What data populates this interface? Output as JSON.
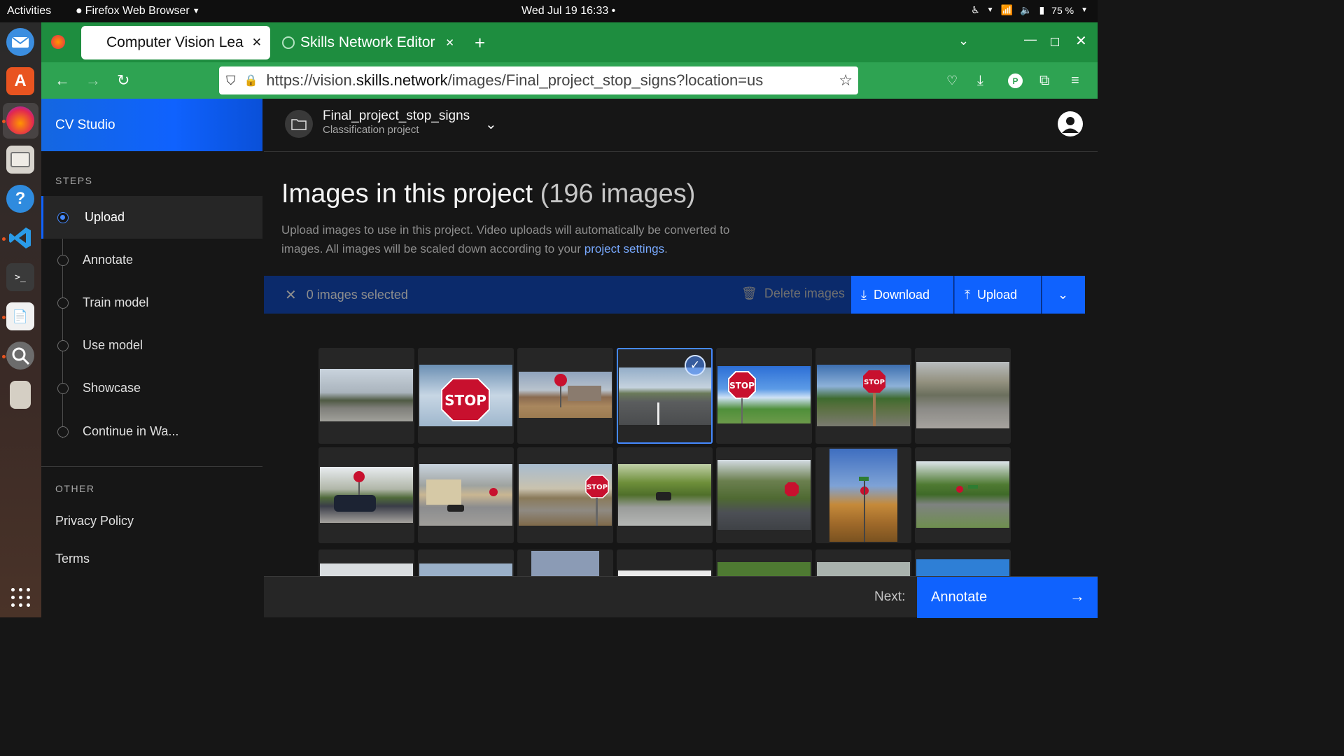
{
  "system": {
    "activities": "Activities",
    "app_menu": "Firefox Web Browser",
    "clock": "Wed Jul 19  16:33",
    "battery": "75 %"
  },
  "browser": {
    "tabs": [
      {
        "title": "Computer Vision Lea",
        "active": true
      },
      {
        "title": "Skills Network Editor",
        "active": false
      }
    ],
    "url_prefix": "https://vision.",
    "url_host": "skills.network",
    "url_path": "/images/Final_project_stop_signs?location=us"
  },
  "app": {
    "brand": "CV Studio",
    "steps_heading": "STEPS",
    "steps": [
      {
        "label": "Upload",
        "current": true
      },
      {
        "label": "Annotate"
      },
      {
        "label": "Train model"
      },
      {
        "label": "Use model"
      },
      {
        "label": "Showcase"
      },
      {
        "label": "Continue in Wa..."
      }
    ],
    "other_heading": "OTHER",
    "other_links": [
      "Privacy Policy",
      "Terms"
    ]
  },
  "project": {
    "name": "Final_project_stop_signs",
    "type": "Classification project"
  },
  "main": {
    "title": "Images in this project",
    "count": "(196 images)",
    "description": "Upload images to use in this project. Video uploads will automatically be converted to images. All images will be scaled down according to your ",
    "settings_link": "project settings",
    "description_end": "."
  },
  "actions": {
    "selected": "0 images selected",
    "delete": "Delete images",
    "download": "Download",
    "upload": "Upload"
  },
  "footer": {
    "next_label": "Next:",
    "next_button": "Annotate"
  },
  "images": [
    {
      "scene": "parking-lot",
      "selected": false
    },
    {
      "scene": "stop-closeup-sky",
      "selected": false
    },
    {
      "scene": "stop-building-field",
      "selected": false
    },
    {
      "scene": "street-road",
      "selected": true
    },
    {
      "scene": "stop-blue-sky",
      "selected": false
    },
    {
      "scene": "stop-post-road",
      "selected": false
    },
    {
      "scene": "road-intersection",
      "selected": false
    },
    {
      "scene": "stop-car-motion",
      "selected": false
    },
    {
      "scene": "stop-house-street",
      "selected": false
    },
    {
      "scene": "stop-crosswalk",
      "selected": false
    },
    {
      "scene": "tree-lined-road",
      "selected": false
    },
    {
      "scene": "stop-intersection-trees",
      "selected": false
    },
    {
      "scene": "stop-street-sign-field",
      "selected": false
    },
    {
      "scene": "stop-green-road",
      "selected": false
    }
  ],
  "colors": {
    "accent": "#0f62fe",
    "firefox_green": "#1e8d3f",
    "background": "#161616",
    "action_bar": "#0b2a6b"
  }
}
